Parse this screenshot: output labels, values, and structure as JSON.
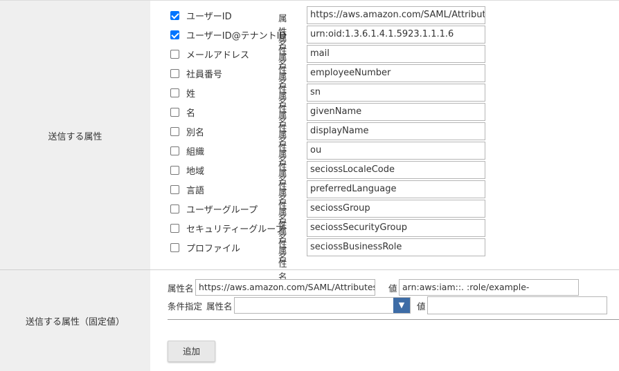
{
  "section_send_attributes": {
    "label": "送信する属性",
    "prop_label": "属性名",
    "rows": [
      {
        "name": "ユーザーID",
        "checked": true,
        "value": "https://aws.amazon.com/SAML/Attributes/I"
      },
      {
        "name": "ユーザーID@テナントID",
        "checked": true,
        "value": "urn:oid:1.3.6.1.4.1.5923.1.1.1.6"
      },
      {
        "name": "メールアドレス",
        "checked": false,
        "value": "mail"
      },
      {
        "name": "社員番号",
        "checked": false,
        "value": "employeeNumber"
      },
      {
        "name": "姓",
        "checked": false,
        "value": "sn"
      },
      {
        "name": "名",
        "checked": false,
        "value": "givenName"
      },
      {
        "name": "別名",
        "checked": false,
        "value": "displayName"
      },
      {
        "name": "組織",
        "checked": false,
        "value": "ou"
      },
      {
        "name": "地域",
        "checked": false,
        "value": "seciossLocaleCode"
      },
      {
        "name": "言語",
        "checked": false,
        "value": "preferredLanguage"
      },
      {
        "name": "ユーザーグループ",
        "checked": false,
        "value": "seciossGroup"
      },
      {
        "name": "セキュリティーグループ",
        "checked": false,
        "value": "seciossSecurityGroup"
      },
      {
        "name": "プロファイル",
        "checked": false,
        "value": "seciossBusinessRole"
      }
    ]
  },
  "section_fixed": {
    "label": "送信する属性（固定値）",
    "attr_label": "属性名",
    "attr_value": "https://aws.amazon.com/SAML/Attributes/I",
    "value_label": "値",
    "value_value": "arn:aws:iam::.                    :role/example-",
    "condition_label": "条件指定",
    "condition_attr_label": "属性名",
    "condition_attr_selected": "",
    "condition_value_label": "値",
    "condition_value": "",
    "add_button": "追加"
  }
}
